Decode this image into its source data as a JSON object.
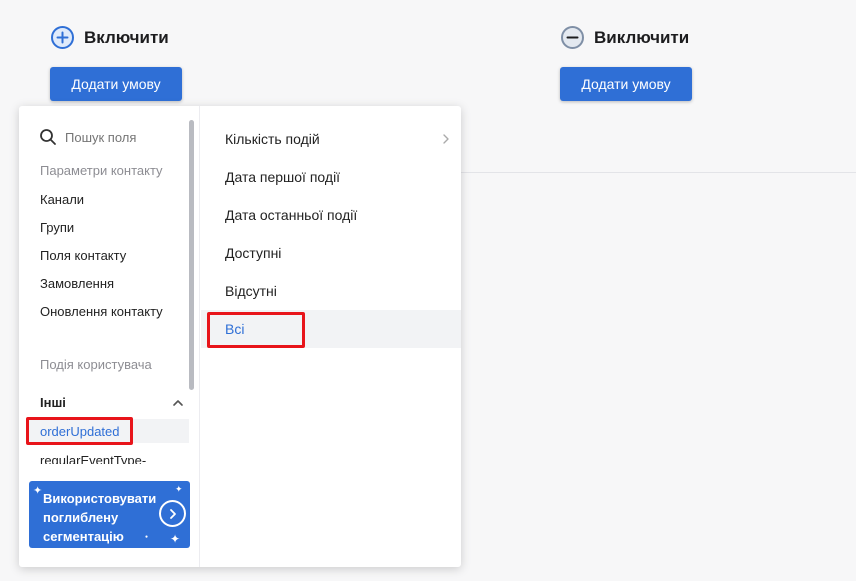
{
  "include": {
    "title": "Включити",
    "button": "Додати умову"
  },
  "exclude": {
    "title": "Виключити",
    "button": "Додати умову"
  },
  "dropdown": {
    "search_placeholder": "Пошук поля",
    "contact_params_label": "Параметри контакту",
    "left_items": [
      "Канали",
      "Групи",
      "Поля контакту",
      "Замовлення",
      "Оновлення контакту"
    ],
    "user_events_label": "Подія користувача",
    "other_group": "Інші",
    "events": [
      "orderUpdated",
      "regularEventType-"
    ],
    "promo_text": "Використовувати поглиблену сегментацію",
    "right_items": [
      "Кількість подій",
      "Дата першої події",
      "Дата останньої події",
      "Доступні",
      "Відсутні",
      "Всі"
    ],
    "selected_right": "Всі"
  },
  "icons": {
    "include": "plus-circle-icon",
    "exclude": "minus-circle-icon",
    "search": "search-icon",
    "collapse": "chevron-up-icon",
    "expand": "chevron-right-icon",
    "promo_arrow": "arrow-right-circle-icon"
  },
  "colors": {
    "accent": "#2f6fd6",
    "highlight": "#e8141a"
  }
}
